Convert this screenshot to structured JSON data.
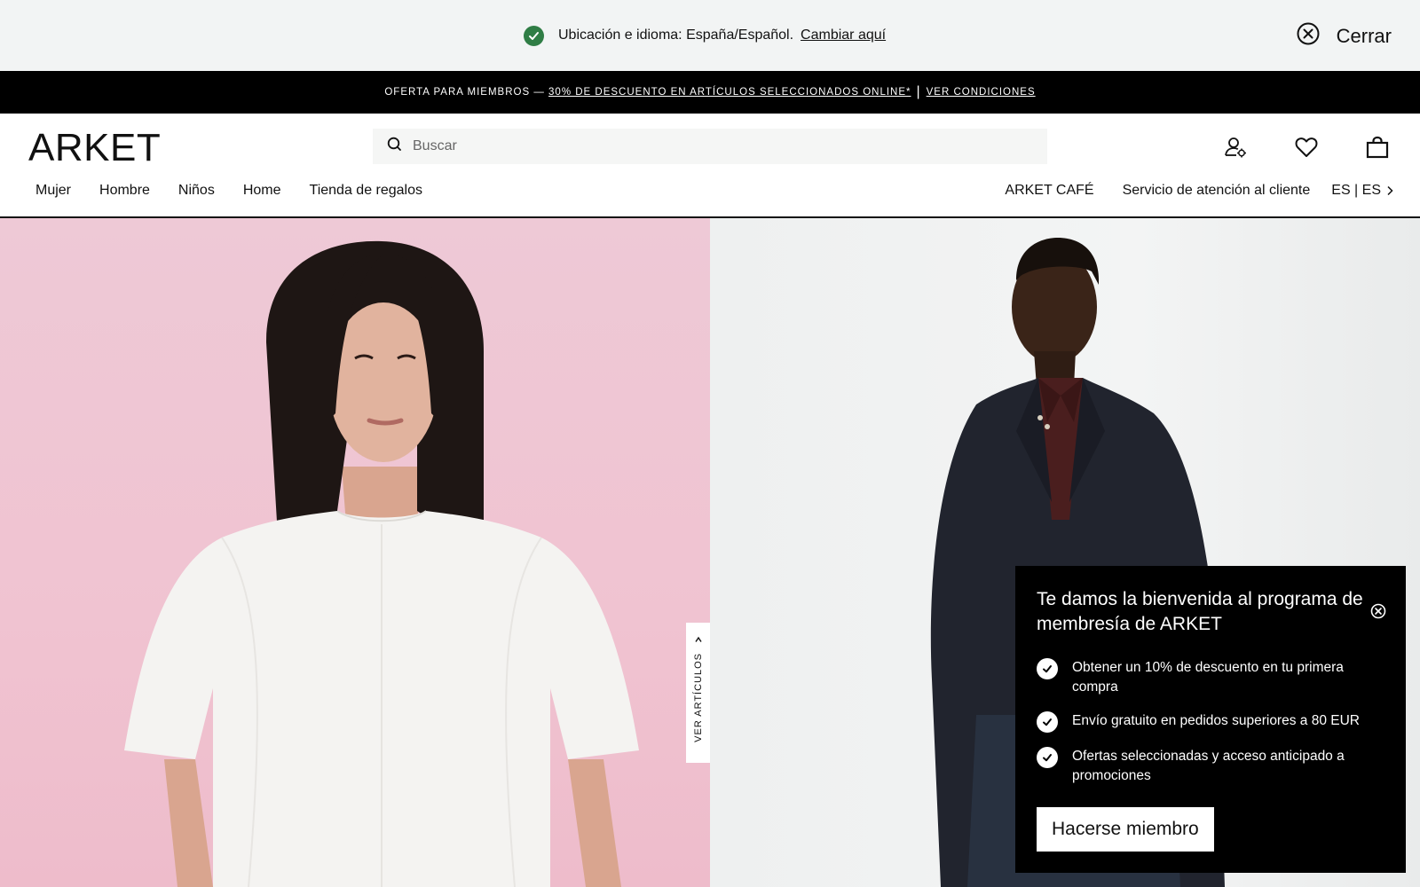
{
  "location_bar": {
    "message": "Ubicación e idioma: España/Español.",
    "change_link": "Cambiar aquí",
    "close_label": "Cerrar"
  },
  "promo_bar": {
    "lead": "OFERTA PARA MIEMBROS —",
    "offer_link": "30% DE DESCUENTO EN ARTÍCULOS SELECCIONADOS ONLINE*",
    "separator": "|",
    "conditions_link": "VER CONDICIONES"
  },
  "header": {
    "logo": "ARKET",
    "search_placeholder": "Buscar",
    "icons": [
      "account-icon",
      "wishlist-heart-icon",
      "shopping-bag-icon"
    ]
  },
  "nav": {
    "left": [
      "Mujer",
      "Hombre",
      "Niños",
      "Home",
      "Tienda de regalos"
    ],
    "right": [
      "ARKET CAFÉ",
      "Servicio de atención al cliente"
    ],
    "language": "ES | ES"
  },
  "hero": {
    "view_items_tab": "VER ARTÍCULOS"
  },
  "membership_popup": {
    "title": "Te damos la bienvenida al programa de membresía de ARKET",
    "benefits": [
      "Obtener un 10% de descuento en tu primera compra",
      "Envío gratuito en pedidos superiores a 80 EUR",
      "Ofertas seleccionadas y acceso anticipado a promociones"
    ],
    "join_button": "Hacerse miembro"
  },
  "colors": {
    "success_green": "#2f7d45",
    "promo_bg": "#000000",
    "location_bar_bg": "#f2f4f4",
    "hero_left_bg": "#eec9d6",
    "hero_right_bg": "#eef0f0"
  }
}
